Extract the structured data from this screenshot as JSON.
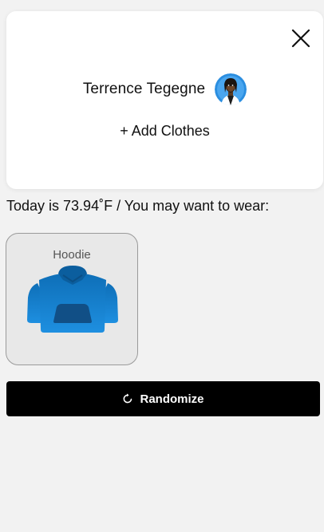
{
  "profile": {
    "username": "Terrence Tegegne",
    "add_clothes_label": "+ Add Clothes",
    "avatar_icon": "user-avatar-icon",
    "close_icon": "close-icon"
  },
  "weather": {
    "text": "Today is 73.94˚F / You may want to wear:"
  },
  "recommendations": [
    {
      "name": "Hoodie",
      "icon": "hoodie-icon",
      "color": "#1a7fd0"
    }
  ],
  "actions": {
    "randomize_label": "Randomize",
    "randomize_icon": "refresh-icon"
  },
  "colors": {
    "background": "#f2f2f2",
    "card": "#ffffff",
    "button": "#000000",
    "accent": "#1a7fd0"
  }
}
